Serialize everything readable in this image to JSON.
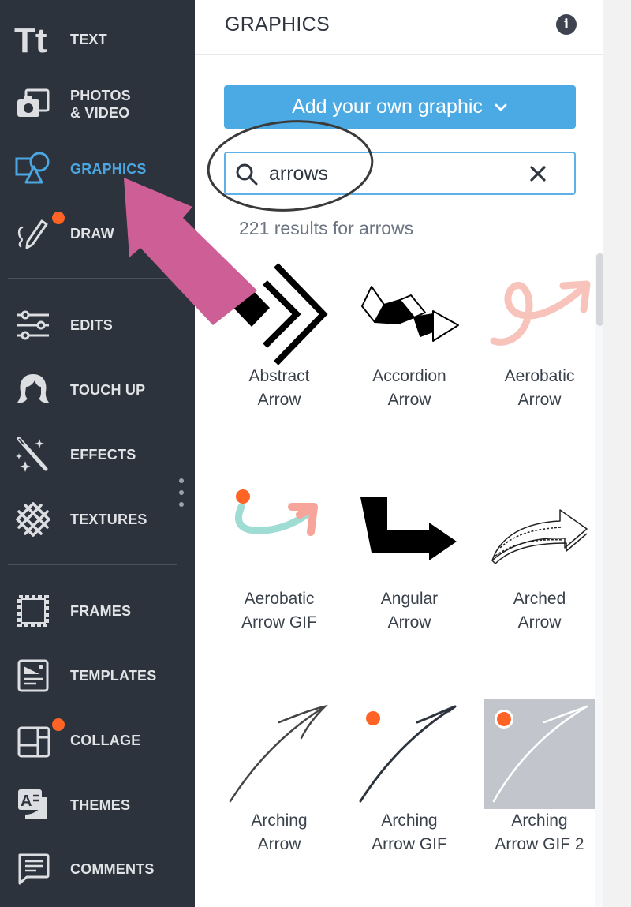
{
  "sidebar": {
    "items": [
      {
        "label": "TEXT",
        "icon": "text-icon",
        "active": false,
        "badge": false
      },
      {
        "label_line1": "PHOTOS",
        "label_line2": "& VIDEO",
        "icon": "photo-video-icon",
        "active": false,
        "badge": false
      },
      {
        "label": "GRAPHICS",
        "icon": "shapes-icon",
        "active": true,
        "badge": false
      },
      {
        "label": "DRAW",
        "icon": "pencil-draw-icon",
        "active": false,
        "badge": true
      },
      {
        "label": "EDITS",
        "icon": "sliders-icon",
        "active": false,
        "badge": false
      },
      {
        "label": "TOUCH UP",
        "icon": "face-icon",
        "active": false,
        "badge": false
      },
      {
        "label": "EFFECTS",
        "icon": "magic-wand-icon",
        "active": false,
        "badge": false
      },
      {
        "label": "TEXTURES",
        "icon": "texture-grid-icon",
        "active": false,
        "badge": false
      },
      {
        "label": "FRAMES",
        "icon": "stamp-frame-icon",
        "active": false,
        "badge": false
      },
      {
        "label": "TEMPLATES",
        "icon": "template-icon",
        "active": false,
        "badge": false
      },
      {
        "label": "COLLAGE",
        "icon": "collage-icon",
        "active": false,
        "badge": true
      },
      {
        "label": "THEMES",
        "icon": "themes-icon",
        "active": false,
        "badge": false
      },
      {
        "label": "COMMENTS",
        "icon": "comment-icon",
        "active": false,
        "badge": false
      }
    ]
  },
  "panel": {
    "title": "GRAPHICS",
    "info_icon": "i",
    "add_button_label": "Add your own graphic",
    "search": {
      "value": "arrows",
      "placeholder": ""
    },
    "results_text": "221 results for arrows",
    "graphics": [
      {
        "line1": "Abstract",
        "line2": "Arrow",
        "gif": false
      },
      {
        "line1": "Accordion",
        "line2": "Arrow",
        "gif": false
      },
      {
        "line1": "Aerobatic",
        "line2": "Arrow",
        "gif": false
      },
      {
        "line1": "Aerobatic",
        "line2": "Arrow GIF",
        "gif": true
      },
      {
        "line1": "Angular",
        "line2": "Arrow",
        "gif": false
      },
      {
        "line1": "Arched",
        "line2": "Arrow",
        "gif": false
      },
      {
        "line1": "Arching",
        "line2": "Arrow",
        "gif": false
      },
      {
        "line1": "Arching",
        "line2": "Arrow GIF",
        "gif": true
      },
      {
        "line1": "Arching",
        "line2": "Arrow GIF 2",
        "gif": true
      }
    ]
  },
  "colors": {
    "sidebar_bg": "#2d333d",
    "accent": "#4ba9e3",
    "badge": "#ff6325",
    "annotation_arrow": "#cd5f96"
  }
}
